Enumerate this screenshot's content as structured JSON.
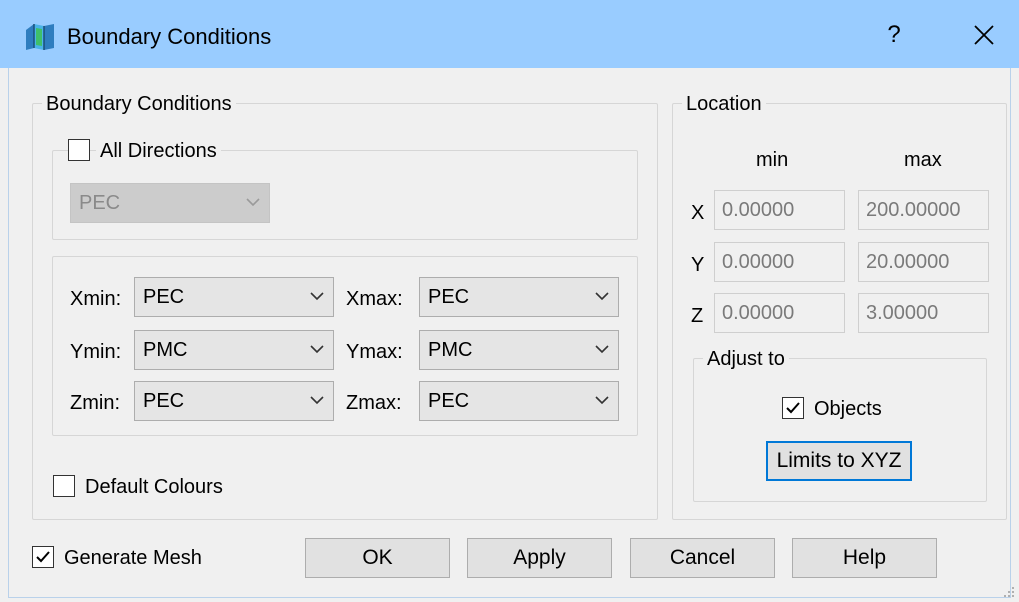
{
  "window": {
    "title": "Boundary Conditions",
    "help_label": "?",
    "close_label": "✕"
  },
  "boundary": {
    "group_label": "Boundary Conditions",
    "all_directions": {
      "label": "All Directions",
      "checked": false
    },
    "all_combo_value": "PEC",
    "rows": [
      {
        "min_label": "Xmin:",
        "min_value": "PEC",
        "max_label": "Xmax:",
        "max_value": "PEC"
      },
      {
        "min_label": "Ymin:",
        "min_value": "PMC",
        "max_label": "Ymax:",
        "max_value": "PMC"
      },
      {
        "min_label": "Zmin:",
        "min_value": "PEC",
        "max_label": "Zmax:",
        "max_value": "PEC"
      }
    ],
    "default_colours": {
      "label": "Default Colours",
      "checked": false
    }
  },
  "location": {
    "group_label": "Location",
    "min_header": "min",
    "max_header": "max",
    "axes": [
      {
        "label": "X",
        "min": "0.00000",
        "max": "200.00000"
      },
      {
        "label": "Y",
        "min": "0.00000",
        "max": "20.00000"
      },
      {
        "label": "Z",
        "min": "0.00000",
        "max": "3.00000"
      }
    ],
    "adjust_group_label": "Adjust to",
    "objects": {
      "label": "Objects",
      "checked": true
    },
    "limits_button": "Limits to XYZ"
  },
  "footer": {
    "generate_mesh": {
      "label": "Generate Mesh",
      "checked": true
    },
    "ok_label": "OK",
    "apply_label": "Apply",
    "cancel_label": "Cancel",
    "help_label": "Help"
  },
  "colors": {
    "titlebar": "#99ccff",
    "dialog_bg": "#f0f0f0",
    "focus_border": "#0078d7"
  }
}
